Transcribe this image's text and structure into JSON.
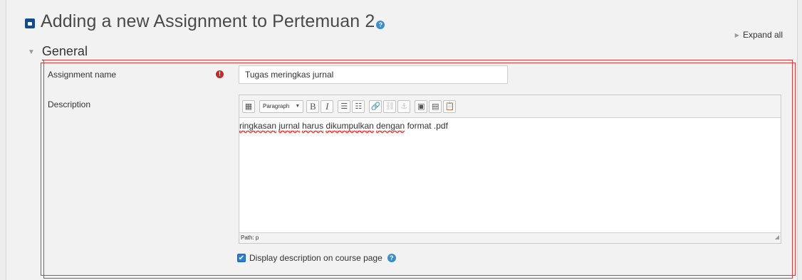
{
  "page": {
    "title": "Adding a new Assignment to Pertemuan 2",
    "title_icon": "assignment-icon",
    "help_icon": "question-circle-icon",
    "expand_all": "Expand all"
  },
  "section": {
    "title": "General"
  },
  "fields": {
    "assignment_name_label": "Assignment name",
    "assignment_name_value": "Tugas meringkas jurnal",
    "required_icon": "!",
    "description_label": "Description"
  },
  "editor": {
    "format_select": "Paragraph",
    "toolbar_buttons": {
      "toggle": "▦",
      "bold": "B",
      "italic": "I",
      "unordered_list": "☰",
      "ordered_list": "☷",
      "link": "🔗",
      "unlink": "⛓",
      "anchor": "⚓",
      "image": "▣",
      "media": "▤",
      "paste": "📋"
    },
    "content_words": [
      "ringkasan",
      "jurnal",
      "harus",
      "dikumpulkan",
      "dengan",
      "format .pdf"
    ],
    "path": "Path: p"
  },
  "display_description": {
    "label": "Display description on course page",
    "checked": true,
    "check_glyph": "✔"
  },
  "colors": {
    "accent": "#2a7fd4",
    "outline": "#e03a3a",
    "title_icon": "#0f4d8f",
    "required": "#c62828"
  }
}
